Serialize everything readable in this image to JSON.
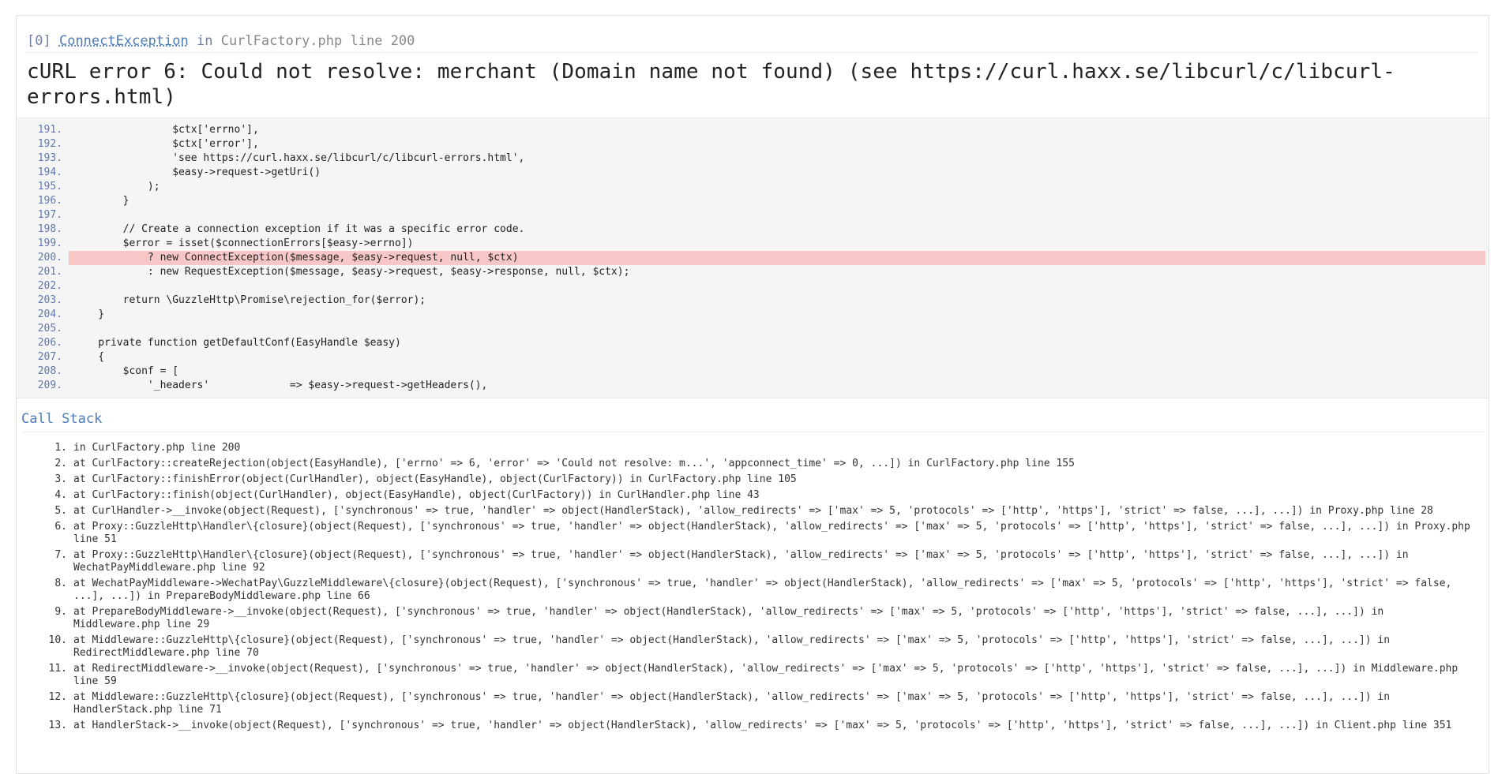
{
  "exception": {
    "index": "[0]",
    "class": "ConnectException",
    "in_word": "in",
    "file": "CurlFactory.php line 200",
    "message": "cURL error 6: Could not resolve: merchant (Domain name not found) (see https://curl.haxx.se/libcurl/c/libcurl-errors.html)"
  },
  "code": {
    "highlight_line": "200.",
    "lines": [
      {
        "n": "191.",
        "text": "                $ctx['errno'],"
      },
      {
        "n": "192.",
        "text": "                $ctx['error'],"
      },
      {
        "n": "193.",
        "text": "                'see https://curl.haxx.se/libcurl/c/libcurl-errors.html',"
      },
      {
        "n": "194.",
        "text": "                $easy->request->getUri()"
      },
      {
        "n": "195.",
        "text": "            );"
      },
      {
        "n": "196.",
        "text": "        }"
      },
      {
        "n": "197.",
        "text": ""
      },
      {
        "n": "198.",
        "text": "        // Create a connection exception if it was a specific error code."
      },
      {
        "n": "199.",
        "text": "        $error = isset($connectionErrors[$easy->errno])"
      },
      {
        "n": "200.",
        "text": "            ? new ConnectException($message, $easy->request, null, $ctx)"
      },
      {
        "n": "201.",
        "text": "            : new RequestException($message, $easy->request, $easy->response, null, $ctx);"
      },
      {
        "n": "202.",
        "text": ""
      },
      {
        "n": "203.",
        "text": "        return \\GuzzleHttp\\Promise\\rejection_for($error);"
      },
      {
        "n": "204.",
        "text": "    }"
      },
      {
        "n": "205.",
        "text": ""
      },
      {
        "n": "206.",
        "text": "    private function getDefaultConf(EasyHandle $easy)"
      },
      {
        "n": "207.",
        "text": "    {"
      },
      {
        "n": "208.",
        "text": "        $conf = ["
      },
      {
        "n": "209.",
        "text": "            '_headers'             => $easy->request->getHeaders(),"
      }
    ]
  },
  "call_stack": {
    "title": "Call Stack",
    "items": [
      {
        "n": "1.",
        "text": "in CurlFactory.php line 200"
      },
      {
        "n": "2.",
        "text": "at CurlFactory::createRejection(object(EasyHandle), ['errno' => 6, 'error' => 'Could not resolve: m...', 'appconnect_time' => 0, ...]) in CurlFactory.php line 155"
      },
      {
        "n": "3.",
        "text": "at CurlFactory::finishError(object(CurlHandler), object(EasyHandle), object(CurlFactory)) in CurlFactory.php line 105"
      },
      {
        "n": "4.",
        "text": "at CurlFactory::finish(object(CurlHandler), object(EasyHandle), object(CurlFactory)) in CurlHandler.php line 43"
      },
      {
        "n": "5.",
        "text": "at CurlHandler->__invoke(object(Request), ['synchronous' => true, 'handler' => object(HandlerStack), 'allow_redirects' => ['max' => 5, 'protocols' => ['http', 'https'], 'strict' => false, ...], ...]) in Proxy.php line 28"
      },
      {
        "n": "6.",
        "text": "at Proxy::GuzzleHttp\\Handler\\{closure}(object(Request), ['synchronous' => true, 'handler' => object(HandlerStack), 'allow_redirects' => ['max' => 5, 'protocols' => ['http', 'https'], 'strict' => false, ...], ...]) in Proxy.php line 51"
      },
      {
        "n": "7.",
        "text": "at Proxy::GuzzleHttp\\Handler\\{closure}(object(Request), ['synchronous' => true, 'handler' => object(HandlerStack), 'allow_redirects' => ['max' => 5, 'protocols' => ['http', 'https'], 'strict' => false, ...], ...]) in WechatPayMiddleware.php line 92"
      },
      {
        "n": "8.",
        "text": "at WechatPayMiddleware->WechatPay\\GuzzleMiddleware\\{closure}(object(Request), ['synchronous' => true, 'handler' => object(HandlerStack), 'allow_redirects' => ['max' => 5, 'protocols' => ['http', 'https'], 'strict' => false, ...], ...]) in PrepareBodyMiddleware.php line 66"
      },
      {
        "n": "9.",
        "text": "at PrepareBodyMiddleware->__invoke(object(Request), ['synchronous' => true, 'handler' => object(HandlerStack), 'allow_redirects' => ['max' => 5, 'protocols' => ['http', 'https'], 'strict' => false, ...], ...]) in Middleware.php line 29"
      },
      {
        "n": "10.",
        "text": "at Middleware::GuzzleHttp\\{closure}(object(Request), ['synchronous' => true, 'handler' => object(HandlerStack), 'allow_redirects' => ['max' => 5, 'protocols' => ['http', 'https'], 'strict' => false, ...], ...]) in RedirectMiddleware.php line 70"
      },
      {
        "n": "11.",
        "text": "at RedirectMiddleware->__invoke(object(Request), ['synchronous' => true, 'handler' => object(HandlerStack), 'allow_redirects' => ['max' => 5, 'protocols' => ['http', 'https'], 'strict' => false, ...], ...]) in Middleware.php line 59"
      },
      {
        "n": "12.",
        "text": "at Middleware::GuzzleHttp\\{closure}(object(Request), ['synchronous' => true, 'handler' => object(HandlerStack), 'allow_redirects' => ['max' => 5, 'protocols' => ['http', 'https'], 'strict' => false, ...], ...]) in HandlerStack.php line 71"
      },
      {
        "n": "13.",
        "text": "at HandlerStack->__invoke(object(Request), ['synchronous' => true, 'handler' => object(HandlerStack), 'allow_redirects' => ['max' => 5, 'protocols' => ['http', 'https'], 'strict' => false, ...], ...]) in Client.php line 351"
      }
    ]
  }
}
